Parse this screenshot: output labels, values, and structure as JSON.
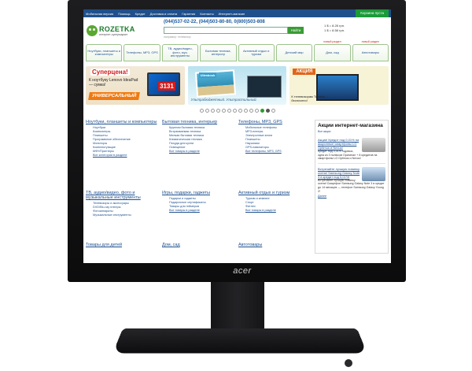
{
  "monitor": {
    "brand": "acer"
  },
  "site": {
    "topbar": {
      "items": [
        "Мобильная версия",
        "Помощь",
        "Кредит",
        "Доставка и оплата",
        "Гарантия",
        "Контакты",
        "Интернет-магазин"
      ],
      "cart": "Корзина пуста"
    },
    "logo": {
      "name": "ROZETKA",
      "tagline": "интернет-супермаркет"
    },
    "phones": "(044)537-02-22, (044)503-80-80, 0(800)503-808",
    "search": {
      "placeholder": "",
      "button": "Найти",
      "hint": "например: телевизор"
    },
    "rates": [
      "1 $ = 8.28 грн.",
      "1 $ = 8.58 грн."
    ],
    "tabs": [
      {
        "label": "Ноутбуки, планшеты и компьютеры",
        "new": ""
      },
      {
        "label": "Телефоны, MP3, GPS",
        "new": ""
      },
      {
        "label": "ТВ, аудио/видео, фото, муз. инструменты",
        "new": ""
      },
      {
        "label": "Бытовая техника, интерьер",
        "new": ""
      },
      {
        "label": "Активный отдых и туризм",
        "new": ""
      },
      {
        "label": "Детский мир",
        "new": ""
      },
      {
        "label": "Дом, сад",
        "new": "новый раздел"
      },
      {
        "label": "Автотовары",
        "new": "новый раздел"
      }
    ],
    "banners": {
      "b1": {
        "title": "Суперцена!",
        "text": "К ноутбуку Lenovo IdeaPad — сумка!",
        "price": "3131",
        "ribbon": "УНИВЕРСАЛЬНЫЙ"
      },
      "b2": {
        "tag": "Ultrabook",
        "text": "Ультрабюджетный. Ультрастильный."
      },
      "b3": {
        "akcia": "АКЦИЯ",
        "text": "К телевизорам Toshiba — бесплатно!"
      }
    },
    "sections": [
      {
        "title": "Ноутбуки, планшеты и компьютеры",
        "items": [
          "Ноутбуки",
          "Компьютеры",
          "Планшеты",
          "Программное обеспечение",
          "Мониторы",
          "Комплектующие",
          "МФУ/Принтеры"
        ],
        "more": "Все категории в разделе"
      },
      {
        "title": "Бытовая техника, интерьер",
        "items": [
          "Крупная бытовая техника",
          "Встраиваемая техника",
          "Мелкая бытовая техника",
          "Климатическая техника",
          "Посуда для кухни",
          "Освещение"
        ],
        "more": "Все товары в разделе"
      },
      {
        "title": "Телефоны, MP3, GPS",
        "items": [
          "Мобильные телефоны",
          "MP3-плееры",
          "Электронные книги",
          "Планшеты",
          "Наушники",
          "GPS-навигаторы"
        ],
        "more": "Все телефоны, MP3, GPS"
      },
      {
        "title": "ТВ, аудио/видео, фото и музыкальные инструменты",
        "items": [
          "Телевизоры и аксессуары",
          "DVD/Blu-ray плееры",
          "Фотоаппараты",
          "Музыкальные инструменты"
        ],
        "more": ""
      },
      {
        "title": "Игры, подарки, гаджеты",
        "items": [
          "Подарки и гаджеты",
          "Подарочные сертификаты",
          "Товары для геймеров"
        ],
        "more": "Все товары в разделе"
      },
      {
        "title": "Активный отдых и туризм",
        "items": [
          "Туризм и кемпинг",
          "Спорт",
          "Фитнес"
        ],
        "more": "Все товары в разделе"
      },
      {
        "title": "Товары для детей",
        "items": [],
        "more": ""
      },
      {
        "title": "Дом, сад",
        "items": [],
        "more": ""
      },
      {
        "title": "Автотовары",
        "items": [],
        "more": ""
      }
    ],
    "promo": {
      "title": "Акции интернет-магазина",
      "all": "Все акции",
      "items": [
        {
          "link": "Акция! Кредит под 0,01% на акционные смартфоны LG Optimus и Nexus!",
          "text": "Кредит под 0,01% годовых, одна из 3 полюсов Оригинал + 8 кредитов на смартфоны LG Optimus и Nexus!"
        },
        {
          "link": "Встречайте лучшую новинку осени! Samsung Galaxy Note 3 в кредит под 0,01%!",
          "text": "Встречайте лучшую новинку осени! Смартфон Samsung Galaxy Note 3 в кредит до 14 месяцев — телефон Samsung Galaxy Young 2!"
        }
      ],
      "more": "Далее"
    }
  }
}
